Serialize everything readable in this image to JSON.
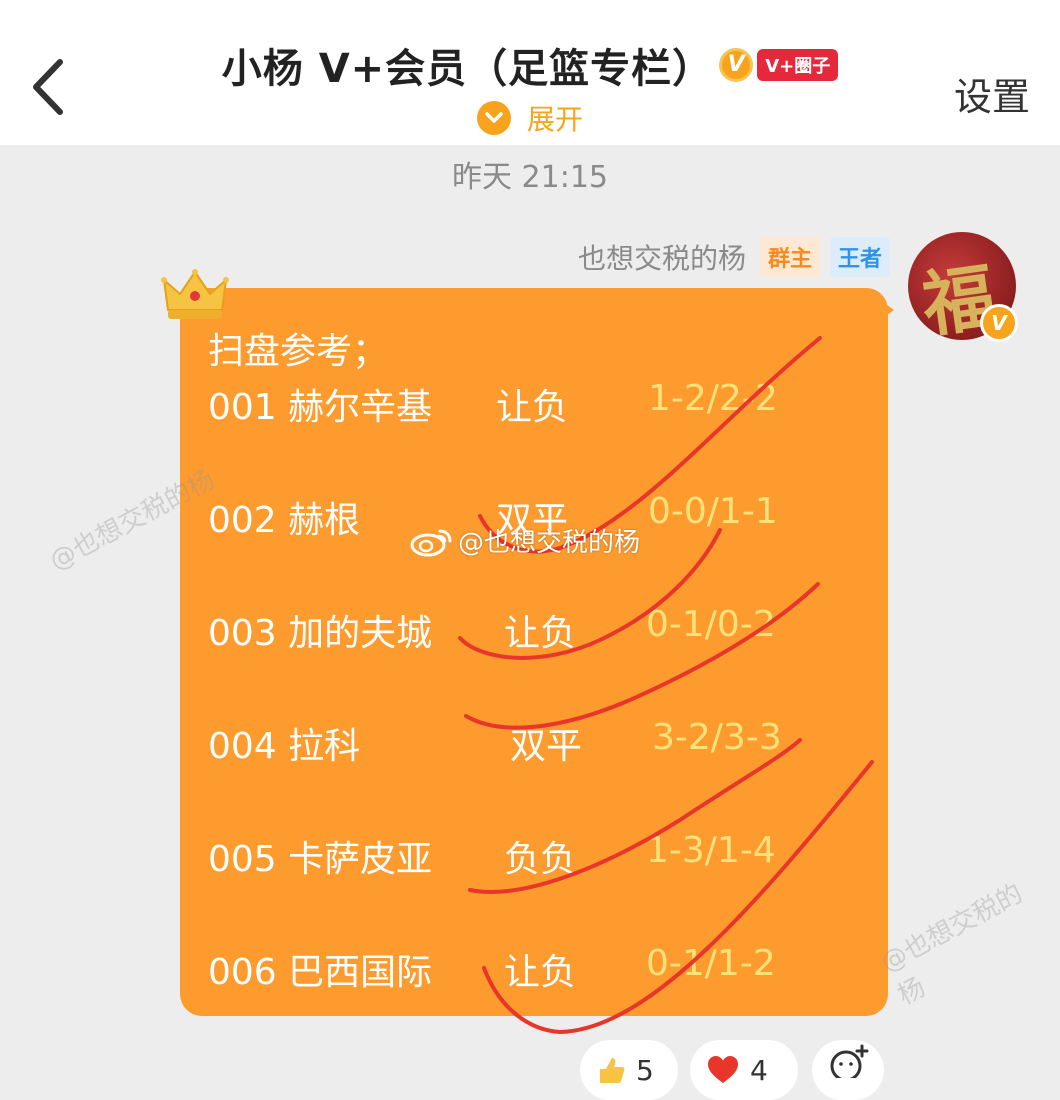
{
  "header": {
    "title": "小杨 V+会员（足篮专栏）",
    "v_badge": "V",
    "circle_tag": "V+圈子",
    "expand_label": "展开",
    "settings_label": "设置"
  },
  "chat": {
    "timestamp": "昨天 21:15",
    "sender": {
      "name": "也想交税的杨",
      "role_owner": "群主",
      "role_king": "王者",
      "avatar_glyph": "福",
      "avatar_badge": "V"
    },
    "message": {
      "intro": "扫盘参考；",
      "lines": [
        {
          "team": "001 赫尔辛基",
          "pick": "让负",
          "score": "1-2/2-2"
        },
        {
          "team": "002 赫根",
          "pick": "双平",
          "score": "0-0/1-1"
        },
        {
          "team": "003 加的夫城",
          "pick": "让负",
          "score": "0-1/0-2"
        },
        {
          "team": "004 拉科",
          "pick": "双平",
          "score": "3-2/3-3"
        },
        {
          "team": "005 卡萨皮亚",
          "pick": "负负",
          "score": "1-3/1-4"
        },
        {
          "team": "006 巴西国际",
          "pick": "让负",
          "score": "0-1/1-2"
        }
      ]
    },
    "watermark": "@也想交税的杨",
    "reactions": [
      {
        "icon": "thumbs-up-icon",
        "count": "5"
      },
      {
        "icon": "heart-icon",
        "count": "4"
      }
    ]
  },
  "colors": {
    "accent": "#f7a31b",
    "bubble": "#fd9b2f",
    "circle_tag": "#e5283b"
  }
}
